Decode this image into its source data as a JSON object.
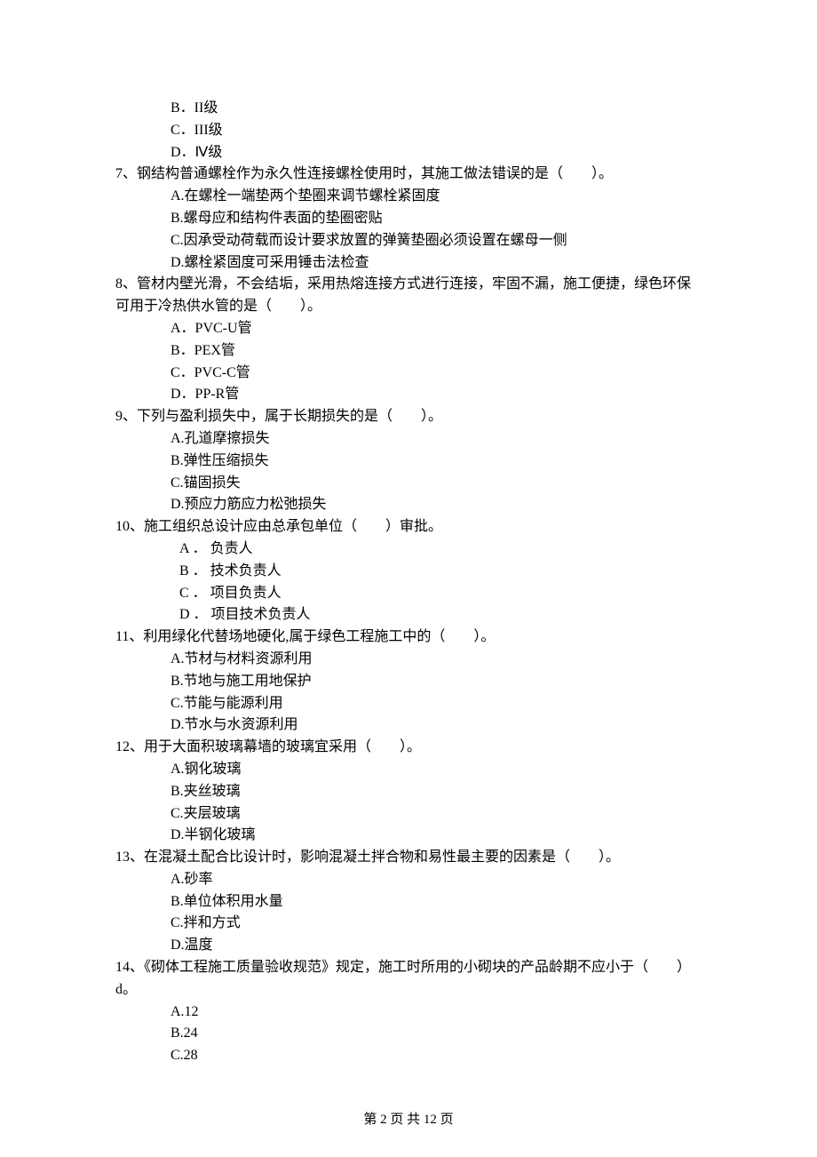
{
  "top_options": [
    "B．II级",
    "C．III级",
    "D．Ⅳ级"
  ],
  "questions": [
    {
      "stem": "7、钢结构普通螺栓作为永久性连接螺栓使用时，其施工做法错误的是（　　）。",
      "options": [
        "A.在螺栓一端垫两个垫圈来调节螺栓紧固度",
        "B.螺母应和结构件表面的垫圈密贴",
        "C.因承受动荷载而设计要求放置的弹簧垫圈必须设置在螺母一侧",
        "D.螺栓紧固度可采用锤击法检查"
      ]
    },
    {
      "stem": "8、管材内壁光滑，不会结垢，采用热熔连接方式进行连接，牢固不漏，施工便捷，绿色环保可用于冷热供水管的是（　　）。",
      "options": [
        "A．PVC-U管",
        "B．PEX管",
        "C．PVC-C管",
        "D．PP-R管"
      ]
    },
    {
      "stem": "9、下列与盈利损失中，属于长期损失的是（　　）。",
      "options": [
        "A.孔道摩擦损失",
        "B.弹性压缩损失",
        "C.锚固损失",
        "D.预应力筋应力松弛损失"
      ]
    },
    {
      "stem": "10、施工组织总设计应由总承包单位（　　）审批。",
      "options": [
        "A ． 负责人",
        "B ． 技术负责人",
        "C ． 项目负责人",
        "D ． 项目技术负责人"
      ],
      "wide": true
    },
    {
      "stem": "11、利用绿化代替场地硬化,属于绿色工程施工中的（　　）。",
      "options": [
        "A.节材与材料资源利用",
        "B.节地与施工用地保护",
        "C.节能与能源利用",
        "D.节水与水资源利用"
      ]
    },
    {
      "stem": "12、用于大面积玻璃幕墙的玻璃宜采用（　　）。",
      "options": [
        "A.钢化玻璃",
        "B.夹丝玻璃",
        "C.夹层玻璃",
        "D.半钢化玻璃"
      ]
    },
    {
      "stem": "13、在混凝土配合比设计时，影响混凝土拌合物和易性最主要的因素是（　　）。",
      "options": [
        "A.砂率",
        "B.单位体积用水量",
        "C.拌和方式",
        "D.温度"
      ]
    },
    {
      "stem": "14、《砌体工程施工质量验收规范》规定，施工时所用的小砌块的产品龄期不应小于（　　）d。",
      "options": [
        "A.12",
        "B.24",
        "C.28"
      ]
    }
  ],
  "footer": "第 2 页 共 12 页"
}
